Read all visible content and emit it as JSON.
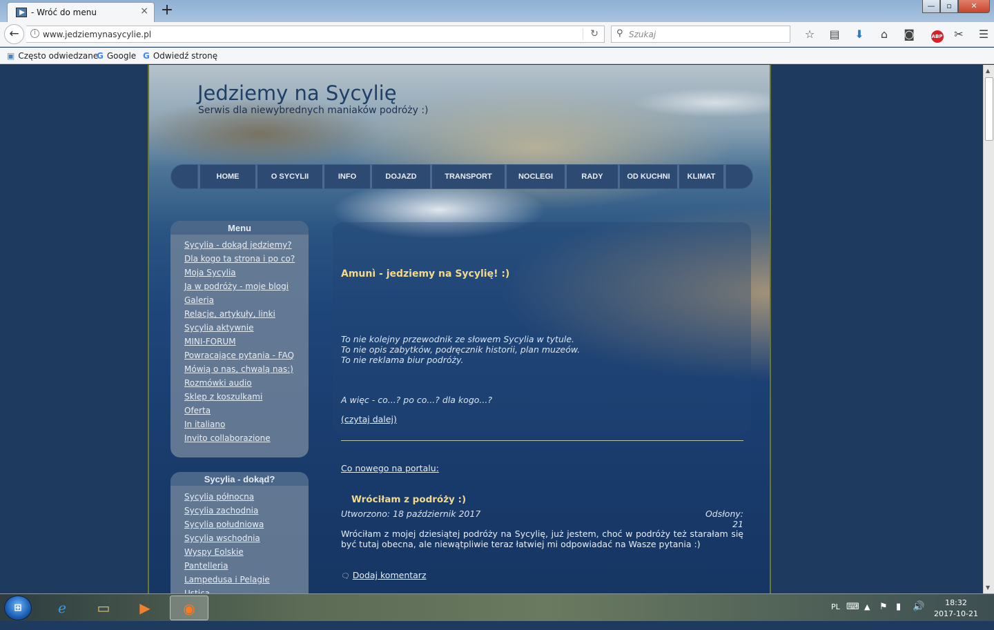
{
  "browser": {
    "tab_title": "- Wróć do menu",
    "tab_close": "×",
    "new_tab": "+",
    "url": "www.jedziemynasycylie.pl",
    "search_placeholder": "Szukaj",
    "bookmarks": [
      "Często odwiedzane",
      "Google",
      "Odwiedź stronę"
    ],
    "window_buttons": {
      "minimize": "—",
      "maximize": "▫",
      "close": "✕"
    }
  },
  "site": {
    "title": "Jedziemy na Sycylię",
    "subtitle": "Serwis dla niewybrednych maniaków podróży :)",
    "nav": [
      "HOME",
      "O SYCYLII",
      "INFO",
      "DOJAZD",
      "TRANSPORT",
      "NOCLEGI",
      "RADY",
      "OD KUCHNI",
      "KLIMAT"
    ]
  },
  "menu_box": {
    "title": "Menu",
    "items": [
      "Sycylia - dokąd jedziemy?",
      "Dla kogo ta strona i po co?",
      "Moja Sycylia",
      "Ja w podróży - moje blogi",
      "Galeria",
      "Relacje, artykuły, linki",
      "Sycylia aktywnie",
      "MINI-FORUM",
      "Powracające pytania - FAQ",
      "Mówią o nas, chwalą nas:)",
      "Rozmówki audio",
      "Sklep z koszulkami",
      "Oferta",
      "In italiano",
      "Invito collaborazione"
    ]
  },
  "dokad_box": {
    "title": "Sycylia - dokąd?",
    "items": [
      "Sycylia północna",
      "Sycylia zachodnia",
      "Sycylia południowa",
      "Sycylia wschodnia",
      "Wyspy Eolskie",
      "Pantelleria",
      "Lampedusa i Pelagie",
      "Ustica"
    ]
  },
  "content": {
    "heading": "Amunì - jedziemy na Sycylię! :)",
    "intro_lines": [
      "To nie kolejny przewodnik ze słowem Sycylia w tytule.",
      "To nie opis zabytków, podręcznik historii, plan muzeów.",
      "To  nie reklama biur podróży."
    ],
    "question": "A więc - co...? po co...? dla kogo...?",
    "read_more": "(czytaj dalej)",
    "news_link": "Co nowego na portalu:",
    "article": {
      "title": "Wróciłam z podróży :)",
      "created": "Utworzono: 18 październik 2017",
      "views": "Odsłony: 21",
      "body": "Wróciłam z mojej dziesiątej podróży na Sycylię, już jestem, choć w podróży też starałam się być tutaj obecna, ale niewątpliwie teraz łatwiej mi odpowiadać na Wasze pytania :)",
      "comment_link": "Dodaj komentarz"
    }
  },
  "taskbar": {
    "language": "PL",
    "time": "18:32",
    "date": "2017-10-21"
  }
}
